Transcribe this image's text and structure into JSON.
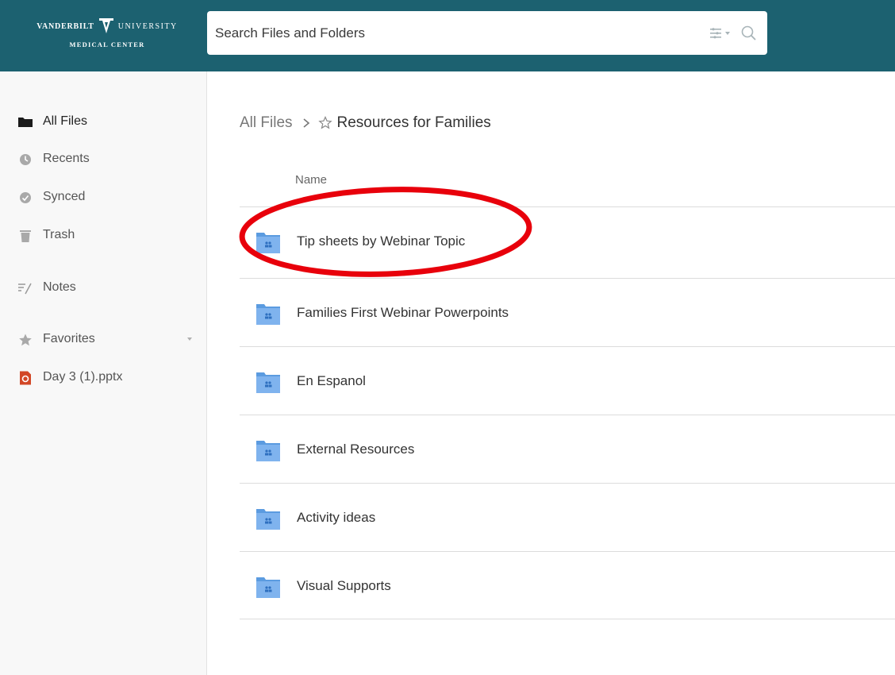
{
  "header": {
    "logo": {
      "line1_left": "VANDERBILT",
      "line1_right": "UNIVERSITY",
      "line2": "MEDICAL CENTER"
    },
    "search": {
      "placeholder": "Search Files and Folders",
      "filter_icon": "filter-options-icon",
      "search_icon": "search-icon"
    }
  },
  "sidebar": {
    "items": [
      {
        "label": "All Files",
        "icon": "folder-icon",
        "active": true
      },
      {
        "label": "Recents",
        "icon": "clock-icon"
      },
      {
        "label": "Synced",
        "icon": "sync-icon"
      },
      {
        "label": "Trash",
        "icon": "trash-icon"
      },
      {
        "label": "Notes",
        "icon": "notes-icon"
      },
      {
        "label": "Favorites",
        "icon": "star-icon"
      },
      {
        "label": "Day 3 (1).pptx",
        "icon": "powerpoint-file-icon"
      }
    ]
  },
  "main": {
    "breadcrumb": {
      "root": "All Files",
      "current": "Resources for Families"
    },
    "column_header": "Name",
    "folders": [
      {
        "name": "Tip sheets by Webinar Topic"
      },
      {
        "name": "Families First Webinar Powerpoints"
      },
      {
        "name": "En Espanol"
      },
      {
        "name": "External Resources"
      },
      {
        "name": "Activity ideas"
      },
      {
        "name": "Visual Supports"
      }
    ]
  },
  "colors": {
    "header_bg": "#1c6170",
    "sidebar_bg": "#f8f8f8",
    "folder_blue": "#6fa8e8",
    "highlight_red": "#e8000b"
  }
}
